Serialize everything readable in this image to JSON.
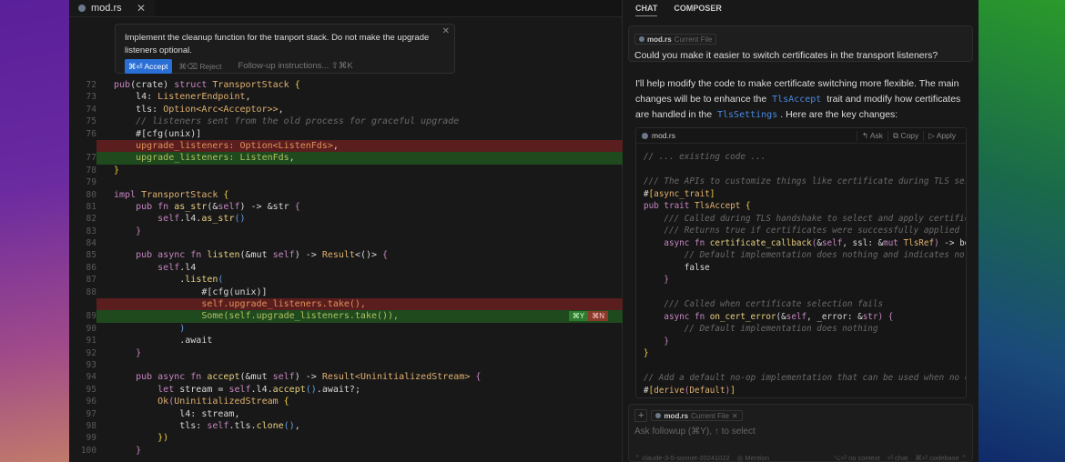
{
  "editor": {
    "tab": {
      "label": "mod.rs",
      "close": "✕"
    },
    "prompt": {
      "text": "Implement the cleanup function for the tranport stack. Do not make the upgrade listeners optional.",
      "accept": "⌘⏎ Accept",
      "reject": "⌘⌫ Reject",
      "followup": "Follow-up instructions... ⇧⌘K",
      "close": "✕"
    },
    "inline_badges": {
      "accept": "⌘Y",
      "reject": "⌘N"
    },
    "lines": [
      {
        "n": "72",
        "tok": [
          [
            "k",
            "pub"
          ],
          [
            "p",
            "(crate) "
          ],
          [
            "k",
            "struct "
          ],
          [
            "t",
            "TransportStack "
          ],
          [
            "y",
            "{"
          ]
        ]
      },
      {
        "n": "73",
        "tok": [
          [
            "p",
            "    l4: "
          ],
          [
            "t",
            "ListenerEndpoint"
          ],
          [
            "p",
            ","
          ]
        ]
      },
      {
        "n": "74",
        "tok": [
          [
            "p",
            "    tls: "
          ],
          [
            "t",
            "Option<Arc<Acceptor>>"
          ],
          [
            "p",
            ","
          ]
        ]
      },
      {
        "n": "75",
        "tok": [
          [
            "c",
            "    // listeners sent from the old process for graceful upgrade"
          ]
        ]
      },
      {
        "n": "76",
        "tok": [
          [
            "p",
            "    #[cfg(unix)]"
          ]
        ]
      },
      {
        "n": "",
        "d": "del",
        "tok": [
          [
            "o",
            "    upgrade_listeners: "
          ],
          [
            "o",
            "Option<ListenFds>"
          ],
          [
            "p",
            ","
          ]
        ]
      },
      {
        "n": "77",
        "d": "add",
        "tok": [
          [
            "g",
            "    upgrade_listeners: "
          ],
          [
            "g",
            "ListenFds"
          ],
          [
            "p",
            ","
          ]
        ]
      },
      {
        "n": "78",
        "tok": [
          [
            "y",
            "}"
          ]
        ]
      },
      {
        "n": "79",
        "tok": []
      },
      {
        "n": "80",
        "tok": [
          [
            "k",
            "impl "
          ],
          [
            "t",
            "TransportStack "
          ],
          [
            "y",
            "{"
          ]
        ]
      },
      {
        "n": "81",
        "tok": [
          [
            "k",
            "    pub fn "
          ],
          [
            "f",
            "as_str"
          ],
          [
            "p",
            "(&"
          ],
          [
            "k",
            "self"
          ],
          [
            "p",
            ") -> &str "
          ],
          [
            "k",
            "{"
          ]
        ]
      },
      {
        "n": "82",
        "tok": [
          [
            "k",
            "        self"
          ],
          [
            "p",
            ".l4."
          ],
          [
            "f",
            "as_str"
          ],
          [
            "b",
            "()"
          ]
        ]
      },
      {
        "n": "83",
        "tok": [
          [
            "k",
            "    }"
          ]
        ]
      },
      {
        "n": "84",
        "tok": []
      },
      {
        "n": "85",
        "tok": [
          [
            "k",
            "    pub async fn "
          ],
          [
            "f",
            "listen"
          ],
          [
            "p",
            "(&mut "
          ],
          [
            "k",
            "self"
          ],
          [
            "p",
            ") -> "
          ],
          [
            "t",
            "Result"
          ],
          [
            "p",
            "<()> "
          ],
          [
            "k",
            "{"
          ]
        ]
      },
      {
        "n": "86",
        "tok": [
          [
            "k",
            "        self"
          ],
          [
            "p",
            ".l4"
          ]
        ]
      },
      {
        "n": "87",
        "tok": [
          [
            "p",
            "            ."
          ],
          [
            "f",
            "listen"
          ],
          [
            "b",
            "("
          ]
        ]
      },
      {
        "n": "88",
        "tok": [
          [
            "p",
            "                #[cfg(unix)]"
          ]
        ]
      },
      {
        "n": "",
        "d": "del",
        "tok": [
          [
            "o",
            "                self.upgrade_listeners.take(),"
          ]
        ]
      },
      {
        "n": "89",
        "d": "add",
        "badges": true,
        "tok": [
          [
            "g",
            "                Some(self.upgrade_listeners.take()),"
          ]
        ]
      },
      {
        "n": "90",
        "tok": [
          [
            "b",
            "            )"
          ]
        ]
      },
      {
        "n": "91",
        "tok": [
          [
            "p",
            "            .await"
          ]
        ]
      },
      {
        "n": "92",
        "tok": [
          [
            "k",
            "    }"
          ]
        ]
      },
      {
        "n": "93",
        "tok": []
      },
      {
        "n": "94",
        "tok": [
          [
            "k",
            "    pub async fn "
          ],
          [
            "f",
            "accept"
          ],
          [
            "p",
            "(&mut "
          ],
          [
            "k",
            "self"
          ],
          [
            "p",
            ") -> "
          ],
          [
            "t",
            "Result<UninitializedStream> "
          ],
          [
            "k",
            "{"
          ]
        ]
      },
      {
        "n": "95",
        "tok": [
          [
            "k",
            "        let "
          ],
          [
            "p",
            "stream = "
          ],
          [
            "k",
            "self"
          ],
          [
            "p",
            ".l4."
          ],
          [
            "f",
            "accept"
          ],
          [
            "b",
            "()"
          ],
          [
            "p",
            ".await?;"
          ]
        ]
      },
      {
        "n": "96",
        "tok": [
          [
            "t",
            "        Ok"
          ],
          [
            "k",
            "("
          ],
          [
            "t",
            "UninitializedStream "
          ],
          [
            "y",
            "{"
          ]
        ]
      },
      {
        "n": "97",
        "tok": [
          [
            "p",
            "            l4: stream,"
          ]
        ]
      },
      {
        "n": "98",
        "tok": [
          [
            "p",
            "            tls: "
          ],
          [
            "k",
            "self"
          ],
          [
            "p",
            ".tls."
          ],
          [
            "f",
            "clone"
          ],
          [
            "b",
            "()"
          ],
          [
            "p",
            ","
          ]
        ]
      },
      {
        "n": "99",
        "tok": [
          [
            "y",
            "        })"
          ]
        ]
      },
      {
        "n": "100",
        "tok": [
          [
            "k",
            "    }"
          ]
        ]
      }
    ]
  },
  "chat": {
    "tabs": [
      "CHAT",
      "COMPOSER"
    ],
    "user": {
      "chip_file": "mod.rs",
      "chip_sub": "Current File",
      "text": "Could you make it easier to switch certificates in the transport listeners?"
    },
    "response": {
      "p1": "I'll help modify the code to make certificate switching more flexible. The main changes will be to enhance the",
      "code1": "TlsAccept",
      "p2": "trait and modify how certificates are handled in the",
      "code2": "TlsSettings",
      "p3": ". Here are the key changes:"
    },
    "block": {
      "file": "mod.rs",
      "ask": "↰ Ask",
      "copy": "⧉ Copy",
      "apply": "▷ Apply",
      "lines": [
        {
          "tok": [
            [
              "c",
              "// ... existing code ..."
            ]
          ]
        },
        {
          "tok": []
        },
        {
          "tok": [
            [
              "c",
              "/// The APIs to customize things like certificate during TLS ser"
            ]
          ]
        },
        {
          "tok": [
            [
              "p",
              "#"
            ],
            [
              "y",
              "["
            ],
            [
              "t",
              "async_trait"
            ],
            [
              "y",
              "]"
            ]
          ]
        },
        {
          "tok": [
            [
              "k",
              "pub trait "
            ],
            [
              "t",
              "TlsAccept "
            ],
            [
              "y",
              "{"
            ]
          ]
        },
        {
          "tok": [
            [
              "c",
              "    /// Called during TLS handshake to select and apply certific"
            ]
          ]
        },
        {
          "tok": [
            [
              "c",
              "    /// Returns true if certificates were successfully applied"
            ]
          ]
        },
        {
          "tok": [
            [
              "k",
              "    async fn "
            ],
            [
              "f",
              "certificate_callback"
            ],
            [
              "k",
              "("
            ],
            [
              "p",
              "&"
            ],
            [
              "k",
              "self"
            ],
            [
              "p",
              ", ssl: &"
            ],
            [
              "k",
              "mut "
            ],
            [
              "t",
              "TlsRef"
            ],
            [
              "k",
              ") "
            ],
            [
              "p",
              "-> bo"
            ]
          ]
        },
        {
          "tok": [
            [
              "c",
              "        // Default implementation does nothing and indicates no"
            ]
          ]
        },
        {
          "tok": [
            [
              "p",
              "        false"
            ]
          ]
        },
        {
          "tok": [
            [
              "k",
              "    }"
            ]
          ]
        },
        {
          "tok": []
        },
        {
          "tok": [
            [
              "c",
              "    /// Called when certificate selection fails"
            ]
          ]
        },
        {
          "tok": [
            [
              "k",
              "    async fn "
            ],
            [
              "f",
              "on_cert_error"
            ],
            [
              "p",
              "(&"
            ],
            [
              "k",
              "self"
            ],
            [
              "p",
              ", _error: &"
            ],
            [
              "k",
              "str"
            ],
            [
              "k",
              ") {"
            ]
          ]
        },
        {
          "tok": [
            [
              "c",
              "        // Default implementation does nothing"
            ]
          ]
        },
        {
          "tok": [
            [
              "k",
              "    }"
            ]
          ]
        },
        {
          "tok": [
            [
              "y",
              "}"
            ]
          ]
        },
        {
          "tok": []
        },
        {
          "tok": [
            [
              "c",
              "// Add a default no-op implementation that can be used when no c"
            ]
          ]
        },
        {
          "tok": [
            [
              "p",
              "#"
            ],
            [
              "y",
              "["
            ],
            [
              "t",
              "derive"
            ],
            [
              "k",
              "("
            ],
            [
              "t",
              "Default"
            ],
            [
              "k",
              ")"
            ],
            [
              "y",
              "]"
            ]
          ]
        }
      ]
    },
    "input": {
      "plus": "+",
      "chip_file": "mod.rs",
      "chip_sub": "Current File",
      "chip_close": "✕",
      "placeholder": "Ask followup (⌘Y), ↑ to select",
      "model": "⌃ claude-3-5-sonnet-20241022",
      "mention": "◎ Mention",
      "no_context": "⌥⏎ no context",
      "chat": "⏎ chat",
      "codebase": "⌘⏎ codebase ⌃"
    }
  }
}
